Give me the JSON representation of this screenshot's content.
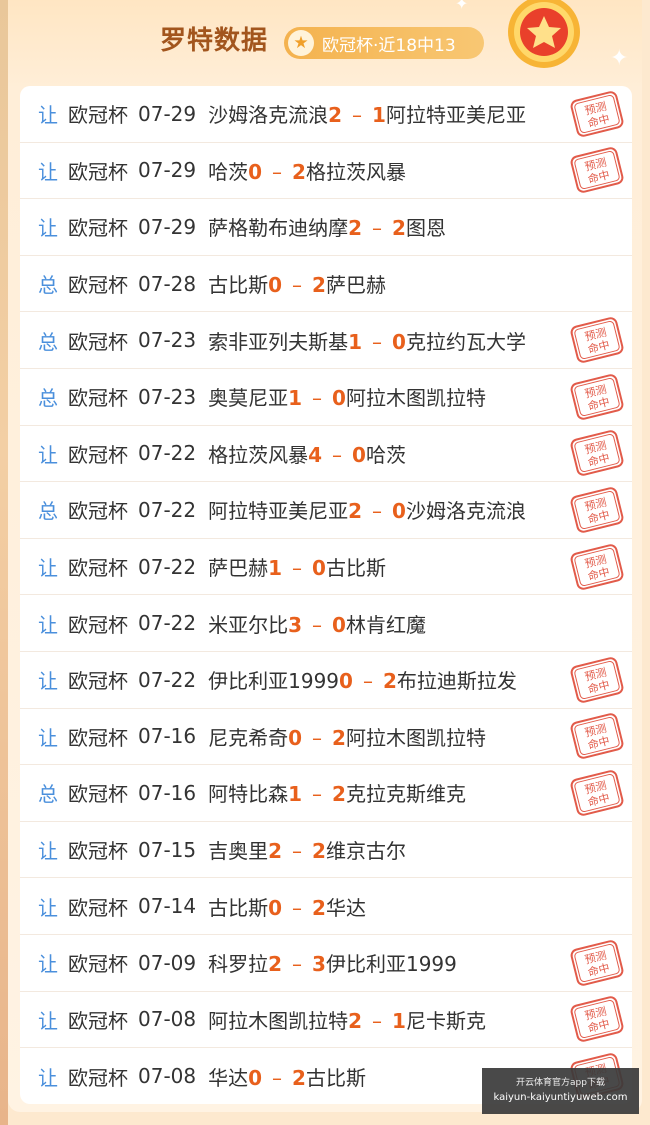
{
  "header": {
    "title": "罗特数据",
    "badge_text": "欧冠杯·近18中13",
    "badge_icon": "star-icon",
    "medal_icon": "star-medal-icon"
  },
  "stamp": {
    "text_line1": "预测",
    "text_line2": "命中",
    "color": "#e25b4a"
  },
  "colors": {
    "type": "#4a8fdc",
    "score": "#e8601c",
    "title": "#a2551d"
  },
  "rows": [
    {
      "type": "让",
      "comp": "欧冠杯",
      "date": "07-29",
      "home": "沙姆洛克流浪",
      "hs": "2",
      "as": "1",
      "away": "阿拉特亚美尼亚",
      "hit": true
    },
    {
      "type": "让",
      "comp": "欧冠杯",
      "date": "07-29",
      "home": "哈茨",
      "hs": "0",
      "as": "2",
      "away": "格拉茨风暴",
      "hit": true
    },
    {
      "type": "让",
      "comp": "欧冠杯",
      "date": "07-29",
      "home": "萨格勒布迪纳摩",
      "hs": "2",
      "as": "2",
      "away": "图恩",
      "hit": false
    },
    {
      "type": "总",
      "comp": "欧冠杯",
      "date": "07-28",
      "home": "古比斯",
      "hs": "0",
      "as": "2",
      "away": "萨巴赫",
      "hit": false
    },
    {
      "type": "总",
      "comp": "欧冠杯",
      "date": "07-23",
      "home": "索非亚列夫斯基",
      "hs": "1",
      "as": "0",
      "away": "克拉约瓦大学",
      "hit": true
    },
    {
      "type": "总",
      "comp": "欧冠杯",
      "date": "07-23",
      "home": "奥莫尼亚",
      "hs": "1",
      "as": "0",
      "away": "阿拉木图凯拉特",
      "hit": true
    },
    {
      "type": "让",
      "comp": "欧冠杯",
      "date": "07-22",
      "home": "格拉茨风暴",
      "hs": "4",
      "as": "0",
      "away": "哈茨",
      "hit": true
    },
    {
      "type": "总",
      "comp": "欧冠杯",
      "date": "07-22",
      "home": "阿拉特亚美尼亚",
      "hs": "2",
      "as": "0",
      "away": "沙姆洛克流浪",
      "hit": true
    },
    {
      "type": "让",
      "comp": "欧冠杯",
      "date": "07-22",
      "home": "萨巴赫",
      "hs": "1",
      "as": "0",
      "away": "古比斯",
      "hit": true
    },
    {
      "type": "让",
      "comp": "欧冠杯",
      "date": "07-22",
      "home": "米亚尔比",
      "hs": "3",
      "as": "0",
      "away": "林肯红魔",
      "hit": false
    },
    {
      "type": "让",
      "comp": "欧冠杯",
      "date": "07-22",
      "home": "伊比利亚1999",
      "hs": "0",
      "as": "2",
      "away": "布拉迪斯拉发",
      "hit": true
    },
    {
      "type": "让",
      "comp": "欧冠杯",
      "date": "07-16",
      "home": "尼克希奇",
      "hs": "0",
      "as": "2",
      "away": "阿拉木图凯拉特",
      "hit": true
    },
    {
      "type": "总",
      "comp": "欧冠杯",
      "date": "07-16",
      "home": "阿特比森",
      "hs": "1",
      "as": "2",
      "away": "克拉克斯维克",
      "hit": true
    },
    {
      "type": "让",
      "comp": "欧冠杯",
      "date": "07-15",
      "home": "吉奥里",
      "hs": "2",
      "as": "2",
      "away": "维京古尔",
      "hit": false
    },
    {
      "type": "让",
      "comp": "欧冠杯",
      "date": "07-14",
      "home": "古比斯",
      "hs": "0",
      "as": "2",
      "away": "华达",
      "hit": false
    },
    {
      "type": "让",
      "comp": "欧冠杯",
      "date": "07-09",
      "home": "科罗拉",
      "hs": "2",
      "as": "3",
      "away": "伊比利亚1999",
      "hit": true
    },
    {
      "type": "让",
      "comp": "欧冠杯",
      "date": "07-08",
      "home": "阿拉木图凯拉特",
      "hs": "2",
      "as": "1",
      "away": "尼卡斯克",
      "hit": true
    },
    {
      "type": "让",
      "comp": "欧冠杯",
      "date": "07-08",
      "home": "华达",
      "hs": "0",
      "as": "2",
      "away": "古比斯",
      "hit": true
    }
  ],
  "watermark": {
    "line1": "开云体育官方app下载",
    "line2": "kaiyun-kaiyuntiyuweb.com"
  }
}
